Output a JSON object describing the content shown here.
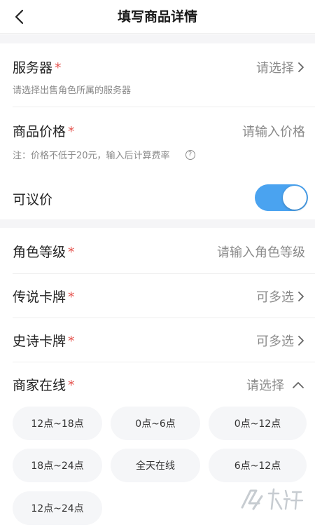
{
  "header": {
    "title": "填写商品详情"
  },
  "server": {
    "label": "服务器",
    "required": "*",
    "value": "请选择",
    "hint": "请选择出售角色所属的服务器"
  },
  "price": {
    "label": "商品价格",
    "required": "*",
    "placeholder": "请输入价格",
    "hint": "注：价格不低于20元，输入后计算费率"
  },
  "negotiable": {
    "label": "可议价",
    "enabled": true
  },
  "level": {
    "label": "角色等级",
    "required": "*",
    "placeholder": "请输入角色等级"
  },
  "legend_cards": {
    "label": "传说卡牌",
    "required": "*",
    "value": "可多选"
  },
  "epic_cards": {
    "label": "史诗卡牌",
    "required": "*",
    "value": "可多选"
  },
  "online": {
    "label": "商家在线",
    "required": "*",
    "value": "请选择",
    "options": [
      "12点~18点",
      "0点~6点",
      "0点~12点",
      "18点~24点",
      "全天在线",
      "6点~12点",
      "12点~24点"
    ]
  },
  "watermark": {
    "text": "九游"
  },
  "colors": {
    "accent": "#4aa3f0",
    "required": "#e5544f",
    "muted": "#8a8a8a",
    "chip_bg": "#f5f6f8"
  }
}
